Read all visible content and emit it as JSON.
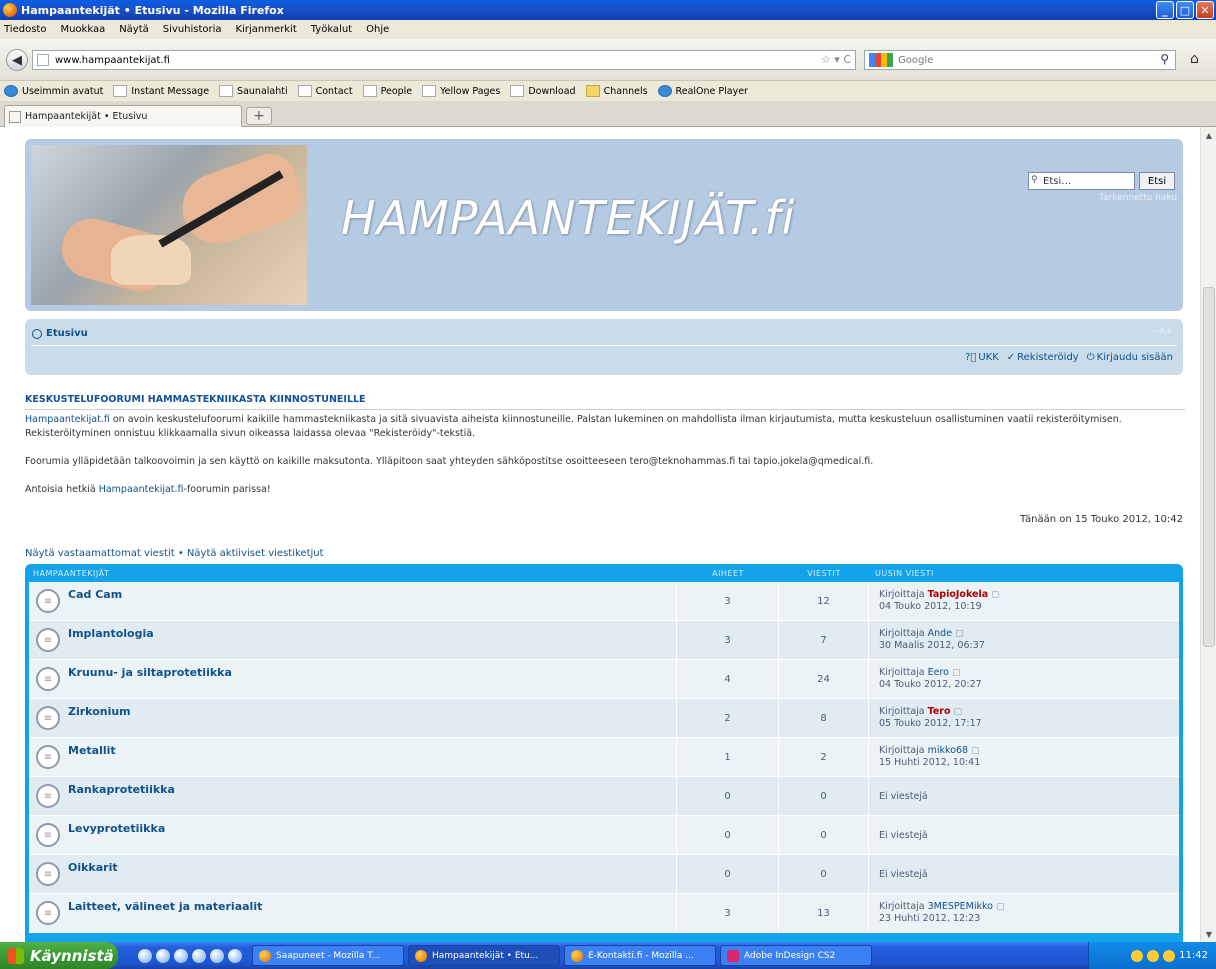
{
  "window": {
    "title": "Hampaantekijät • Etusivu - Mozilla Firefox",
    "min": "_",
    "max": "□",
    "close": "✕"
  },
  "menu": [
    "Tiedosto",
    "Muokkaa",
    "Näytä",
    "Sivuhistoria",
    "Kirjanmerkit",
    "Työkalut",
    "Ohje"
  ],
  "nav": {
    "url": "www.hampaantekijat.fi",
    "url_extra": "☆ ▾ C",
    "search_placeholder": "Google"
  },
  "bookmarks": [
    {
      "label": "Useimmin avatut",
      "icon": "blue"
    },
    {
      "label": "Instant Message",
      "icon": "page"
    },
    {
      "label": "Saunalahti",
      "icon": "page"
    },
    {
      "label": "Contact",
      "icon": "page"
    },
    {
      "label": "People",
      "icon": "page"
    },
    {
      "label": "Yellow Pages",
      "icon": "page"
    },
    {
      "label": "Download",
      "icon": "page"
    },
    {
      "label": "Channels",
      "icon": "folder"
    },
    {
      "label": "RealOne Player",
      "icon": "blue"
    }
  ],
  "tab": {
    "label": "Hampaantekijät • Etusivu",
    "new": "+"
  },
  "header": {
    "logo": "HAMPAANTEKIJÄT.fi",
    "search_value": "Etsi…",
    "search_button": "Etsi",
    "advanced": "Tarkennettu haku"
  },
  "navpanel": {
    "home": "Etusivu",
    "faq": "UKK",
    "register": "Rekisteröidy",
    "login": "Kirjaudu sisään"
  },
  "intro": {
    "heading": "KESKUSTELUFOORUMI HAMMASTEKNIIKASTA KIINNOSTUNEILLE",
    "p1_link": "Hampaantekijat.fi",
    "p1": " on avoin keskustelufoorumi kaikille hammastekniikasta ja sitä sivuavista aiheista kiinnostuneille. Palstan lukeminen on mahdollista ilman kirjautumista, mutta keskusteluun osallistuminen vaatii rekisteröitymisen. Rekisteröityminen onnistuu klikkaamalla sivun oikeassa laidassa olevaa \"Rekisteröidy\"-tekstiä.",
    "p2": "Foorumia ylläpidetään talkoovoimin ja sen käyttö on kaikille maksutonta. Ylläpitoon saat yhteyden sähköpostitse osoitteeseen tero@teknohammas.fi tai tapio.jokela@qmedical.fi.",
    "p3_pre": "Antoisia hetkiä ",
    "p3_link": "Hampaantekijat.fi",
    "p3_post": "-foorumin parissa!"
  },
  "date_line": "Tänään on 15 Touko 2012, 10:42",
  "links_line": "Näytä vastaamattomat viestit • Näytä aktiiviset viestiketjut",
  "forum": {
    "head": {
      "name": "HAMPAANTEKIJÄT",
      "topics": "AIHEET",
      "posts": "VIESTIT",
      "last": "UUSIN VIESTI"
    },
    "rows": [
      {
        "title": "Cad Cam",
        "topics": "3",
        "posts": "12",
        "by": "Kirjoittaja",
        "author": "TapioJokela",
        "red": true,
        "date": "04 Touko 2012, 10:19"
      },
      {
        "title": "Implantologia",
        "topics": "3",
        "posts": "7",
        "by": "Kirjoittaja",
        "author": "Ande",
        "red": false,
        "date": "30 Maalis 2012, 06:37"
      },
      {
        "title": "Kruunu- ja siltaprotetiikka",
        "topics": "4",
        "posts": "24",
        "by": "Kirjoittaja",
        "author": "Eero",
        "red": false,
        "date": "04 Touko 2012, 20:27"
      },
      {
        "title": "Zirkonium",
        "topics": "2",
        "posts": "8",
        "by": "Kirjoittaja",
        "author": "Tero",
        "red": true,
        "date": "05 Touko 2012, 17:17"
      },
      {
        "title": "Metallit",
        "topics": "1",
        "posts": "2",
        "by": "Kirjoittaja",
        "author": "mikko68",
        "red": false,
        "date": "15 Huhti 2012, 10:41"
      },
      {
        "title": "Rankaprotetiikka",
        "topics": "0",
        "posts": "0",
        "none": "Ei viestejä"
      },
      {
        "title": "Levyprotetiikka",
        "topics": "0",
        "posts": "0",
        "none": "Ei viestejä"
      },
      {
        "title": "Oikkarit",
        "topics": "0",
        "posts": "0",
        "none": "Ei viestejä"
      },
      {
        "title": "Laitteet, välineet ja materiaalit",
        "topics": "3",
        "posts": "13",
        "by": "Kirjoittaja",
        "author": "3MESPEMikko",
        "red": false,
        "date": "23 Huhti 2012, 12:23"
      }
    ]
  },
  "taskbar": {
    "start": "Käynnistä",
    "tasks": [
      {
        "label": "Saapuneet - Mozilla T...",
        "icon": "ff",
        "active": false
      },
      {
        "label": "Hampaantekijät • Etu...",
        "icon": "ff",
        "active": true
      },
      {
        "label": "E-Kontakti.fi - Mozilla ...",
        "icon": "ff",
        "active": false
      },
      {
        "label": "Adobe InDesign CS2",
        "icon": "ps",
        "active": false
      }
    ],
    "clock": "11:42"
  }
}
